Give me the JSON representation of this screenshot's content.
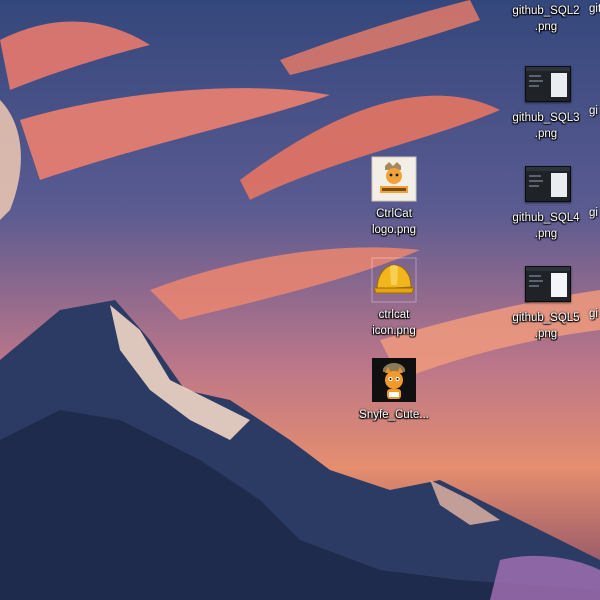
{
  "desktop": {
    "icons": [
      {
        "name": "github_SQL2\n.png"
      },
      {
        "name": "github_SQL3\n.png"
      },
      {
        "name": "github_SQL4\n.png"
      },
      {
        "name": "github_SQL5\n.png"
      },
      {
        "name": "CtrlCat\nlogo.png"
      },
      {
        "name": "ctrlcat\nicon.png"
      },
      {
        "name": "Snyfe_Cute..."
      }
    ],
    "partial": [
      "git",
      "gi",
      "gi",
      "gi"
    ]
  }
}
